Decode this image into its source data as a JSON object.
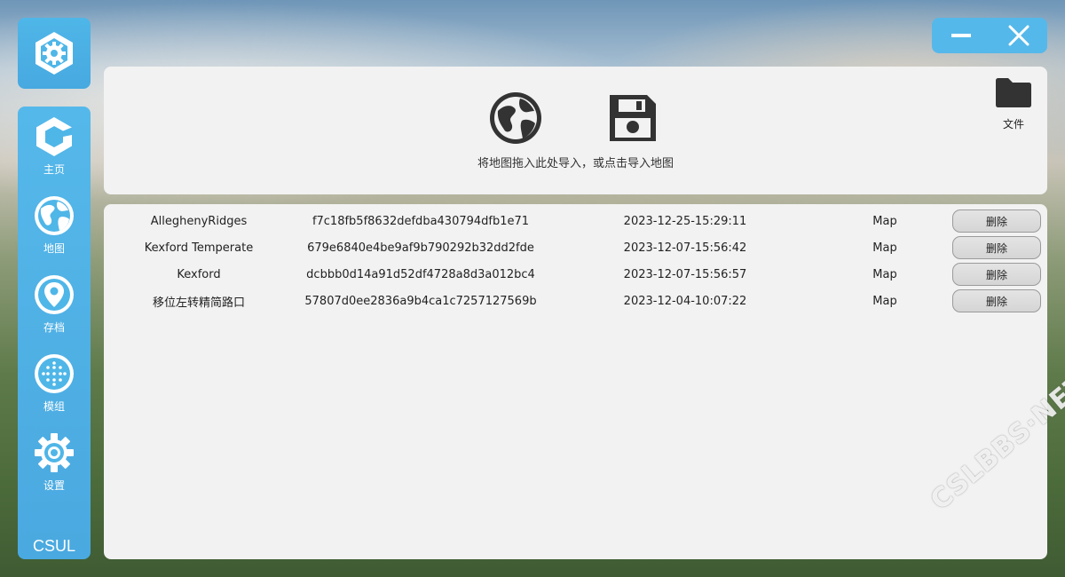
{
  "sidebar": {
    "items": [
      {
        "label": "主页",
        "icon": "hexagon-home-icon"
      },
      {
        "label": "地图",
        "icon": "globe-icon"
      },
      {
        "label": "存档",
        "icon": "location-pin-icon"
      },
      {
        "label": "模组",
        "icon": "dots-grid-icon"
      },
      {
        "label": "设置",
        "icon": "gear-icon"
      }
    ],
    "brand": "CSUL"
  },
  "window": {
    "minimize_icon": "minimize-icon",
    "close_icon": "close-icon"
  },
  "import": {
    "hint": "将地图拖入此处导入，或点击导入地图",
    "file_label": "文件",
    "icons": [
      "globe-icon",
      "save-disk-icon",
      "folder-icon"
    ]
  },
  "maps": {
    "rows": [
      {
        "name": "AlleghenyRidges",
        "hash": "f7c18fb5f8632defdba430794dfb1e71",
        "date": "2023-12-25-15:29:11",
        "type": "Map",
        "delete_label": "删除"
      },
      {
        "name": "Kexford Temperate",
        "hash": "679e6840e4be9af9b790292b32dd2fde",
        "date": "2023-12-07-15:56:42",
        "type": "Map",
        "delete_label": "删除"
      },
      {
        "name": "Kexford",
        "hash": "dcbbb0d14a91d52df4728a8d3a012bc4",
        "date": "2023-12-07-15:56:57",
        "type": "Map",
        "delete_label": "删除"
      },
      {
        "name": "移位左转精简路口",
        "hash": "57807d0ee2836a9b4ca1c7257127569b",
        "date": "2023-12-04-10:07:22",
        "type": "Map",
        "delete_label": "删除"
      }
    ]
  },
  "watermark": "CSLBBS·NET",
  "colors": {
    "accent": "#4fb6e8",
    "panel": "#f2f2f2",
    "icon_dark": "#333333"
  }
}
